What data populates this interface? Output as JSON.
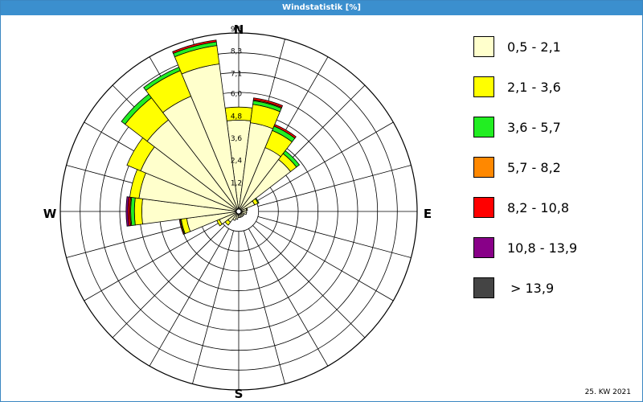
{
  "window": {
    "title": "Windstatistik [%]"
  },
  "footer": {
    "week_label": "25. KW 2021"
  },
  "compass": {
    "north": "N",
    "east": "E",
    "south": "S",
    "west": "W"
  },
  "legend": {
    "items": [
      {
        "label": "0,5 - 2,1",
        "color": "#ffffcc"
      },
      {
        "label": "2,1 - 3,6",
        "color": "#ffff00"
      },
      {
        "label": "3,6 - 5,7",
        "color": "#22ee22"
      },
      {
        "label": "5,7 - 8,2",
        "color": "#ff8800"
      },
      {
        "label": "8,2 - 10,8",
        "color": "#ff0000"
      },
      {
        "label": "10,8 - 13,9",
        "color": "#880088"
      },
      {
        "label": "> 13,9",
        "color": "#444444"
      }
    ]
  },
  "chart_data": {
    "type": "wind_rose",
    "title": "Windstatistik [%]",
    "unit": "%",
    "radial_ticks": [
      "1,2",
      "2,4",
      "3,6",
      "4,8",
      "6,0",
      "7,1",
      "8,3",
      "9,5"
    ],
    "radial_max": 9.5,
    "direction_sector_deg": 15,
    "speed_classes": [
      "0,5 - 2,1",
      "2,1 - 3,6",
      "3,6 - 5,7",
      "5,7 - 8,2",
      "8,2 - 10,8",
      "10,8 - 13,9",
      "> 13,9"
    ],
    "colors": [
      "#ffffcc",
      "#ffff00",
      "#22ee22",
      "#ff8800",
      "#ff0000",
      "#880088",
      "#444444"
    ],
    "sectors": [
      {
        "direction_deg": 0,
        "values": [
          4.8,
          0.7,
          0,
          0,
          0,
          0,
          0
        ]
      },
      {
        "direction_deg": 15,
        "values": [
          4.7,
          1.0,
          0.2,
          0.05,
          0.1,
          0,
          0
        ]
      },
      {
        "direction_deg": 30,
        "values": [
          3.6,
          1.0,
          0.25,
          0,
          0.1,
          0,
          0
        ]
      },
      {
        "direction_deg": 45,
        "values": [
          3.4,
          0.4,
          0.2,
          0,
          0,
          0,
          0
        ]
      },
      {
        "direction_deg": 60,
        "values": [
          0.8,
          0.2,
          0.05,
          0,
          0,
          0,
          0
        ]
      },
      {
        "direction_deg": 75,
        "values": [
          0.3,
          0.05,
          0,
          0,
          0,
          0,
          0
        ]
      },
      {
        "direction_deg": 90,
        "values": [
          0.3,
          0,
          0,
          0,
          0,
          0,
          0
        ]
      },
      {
        "direction_deg": 105,
        "values": [
          0.3,
          0,
          0,
          0,
          0,
          0,
          0
        ]
      },
      {
        "direction_deg": 120,
        "values": [
          0.2,
          0,
          0,
          0,
          0,
          0,
          0
        ]
      },
      {
        "direction_deg": 135,
        "values": [
          0.2,
          0,
          0,
          0,
          0,
          0,
          0
        ]
      },
      {
        "direction_deg": 150,
        "values": [
          0.2,
          0,
          0,
          0,
          0,
          0,
          0
        ]
      },
      {
        "direction_deg": 165,
        "values": [
          0.2,
          0,
          0,
          0,
          0,
          0,
          0
        ]
      },
      {
        "direction_deg": 180,
        "values": [
          0.2,
          0,
          0,
          0,
          0,
          0,
          0
        ]
      },
      {
        "direction_deg": 195,
        "values": [
          0.3,
          0,
          0,
          0,
          0,
          0,
          0
        ]
      },
      {
        "direction_deg": 210,
        "values": [
          0.4,
          0,
          0,
          0,
          0,
          0,
          0
        ]
      },
      {
        "direction_deg": 225,
        "values": [
          0.6,
          0.2,
          0,
          0,
          0,
          0,
          0
        ]
      },
      {
        "direction_deg": 240,
        "values": [
          1.0,
          0.15,
          0,
          0,
          0,
          0,
          0
        ]
      },
      {
        "direction_deg": 255,
        "values": [
          2.7,
          0.3,
          0.05,
          0,
          0.05,
          0,
          0
        ]
      },
      {
        "direction_deg": 270,
        "values": [
          5.1,
          0.4,
          0.2,
          0.05,
          0.1,
          0.1,
          0
        ]
      },
      {
        "direction_deg": 285,
        "values": [
          5.3,
          0.5,
          0,
          0,
          0,
          0,
          0
        ]
      },
      {
        "direction_deg": 300,
        "values": [
          5.6,
          0.8,
          0,
          0,
          0,
          0,
          0
        ]
      },
      {
        "direction_deg": 315,
        "values": [
          6.1,
          1.5,
          0.25,
          0,
          0,
          0,
          0
        ]
      },
      {
        "direction_deg": 330,
        "values": [
          6.6,
          1.5,
          0.2,
          0,
          0,
          0,
          0
        ]
      },
      {
        "direction_deg": 345,
        "values": [
          7.9,
          1.0,
          0.2,
          0,
          0.1,
          0,
          0
        ]
      }
    ]
  }
}
